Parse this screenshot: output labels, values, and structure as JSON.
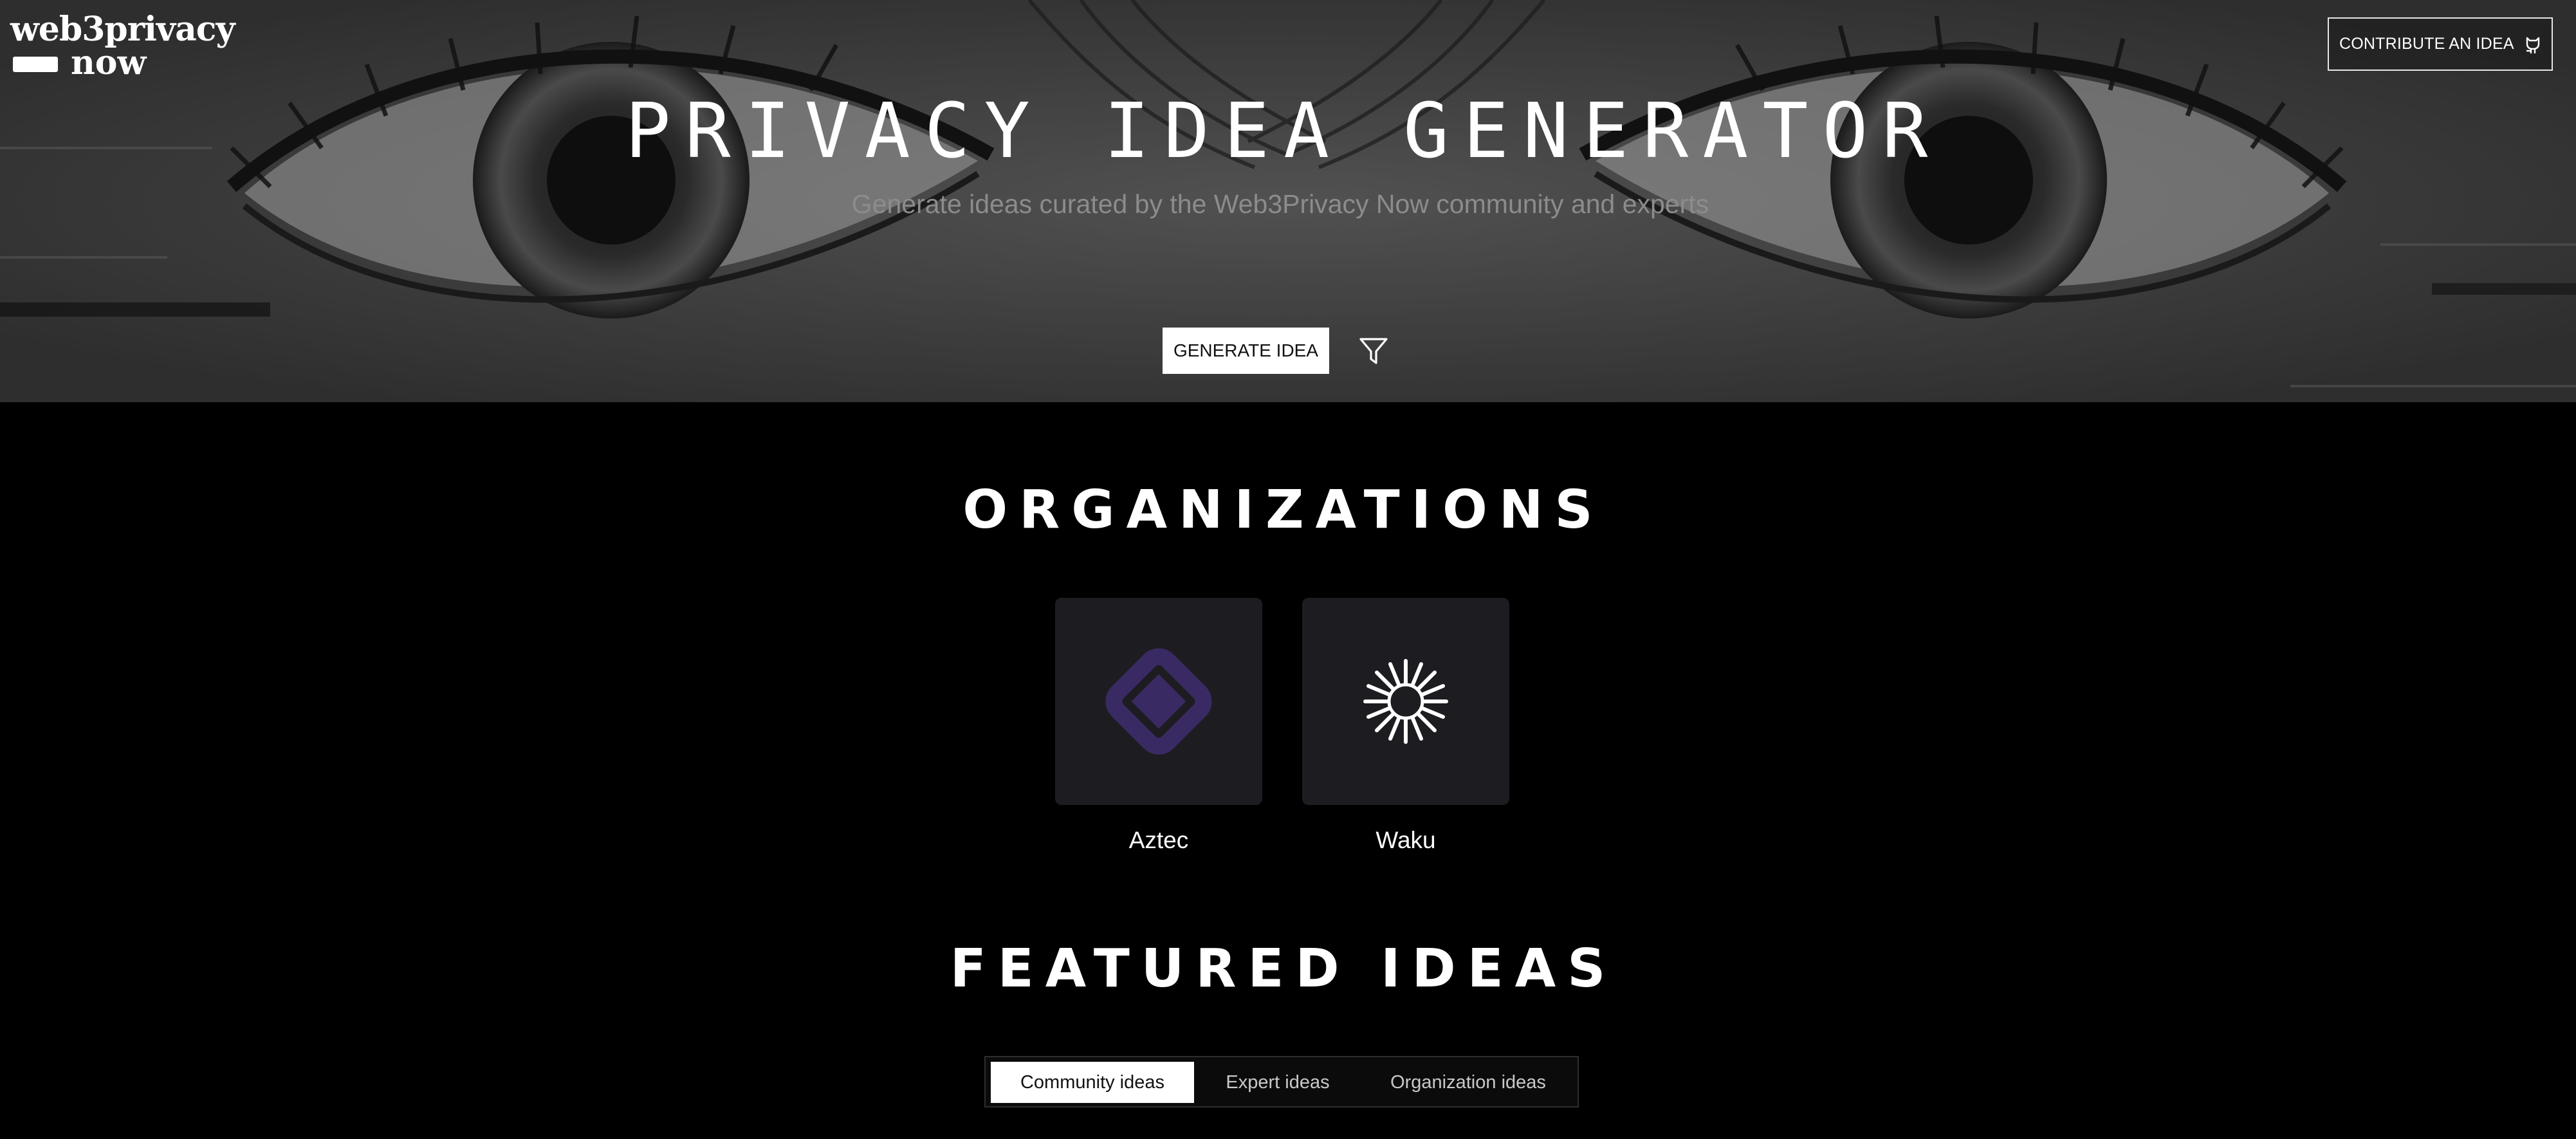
{
  "header": {
    "logo_line1": "web3privacy",
    "logo_line2": "now",
    "contribute_label": "CONTRIBUTE AN IDEA",
    "contribute_icon": "github-icon"
  },
  "hero": {
    "title": "PRIVACY IDEA GENERATOR",
    "subtitle": "Generate ideas curated by the Web3Privacy Now community and experts",
    "generate_label": "GENERATE IDEA",
    "filter_icon": "filter-icon"
  },
  "organizations": {
    "title": "ORGANIZATIONS",
    "items": [
      {
        "name": "Aztec",
        "icon": "aztec-logo",
        "accent": "#3a2a63"
      },
      {
        "name": "Waku",
        "icon": "waku-logo",
        "accent": "#ffffff"
      }
    ]
  },
  "featured": {
    "title": "FEATURED IDEAS",
    "tabs": [
      {
        "label": "Community ideas",
        "active": true
      },
      {
        "label": "Expert ideas",
        "active": false
      },
      {
        "label": "Organization ideas",
        "active": false
      }
    ]
  },
  "colors": {
    "background": "#000000",
    "card": "#1d1c20",
    "subtitle": "#8c8c8c"
  }
}
